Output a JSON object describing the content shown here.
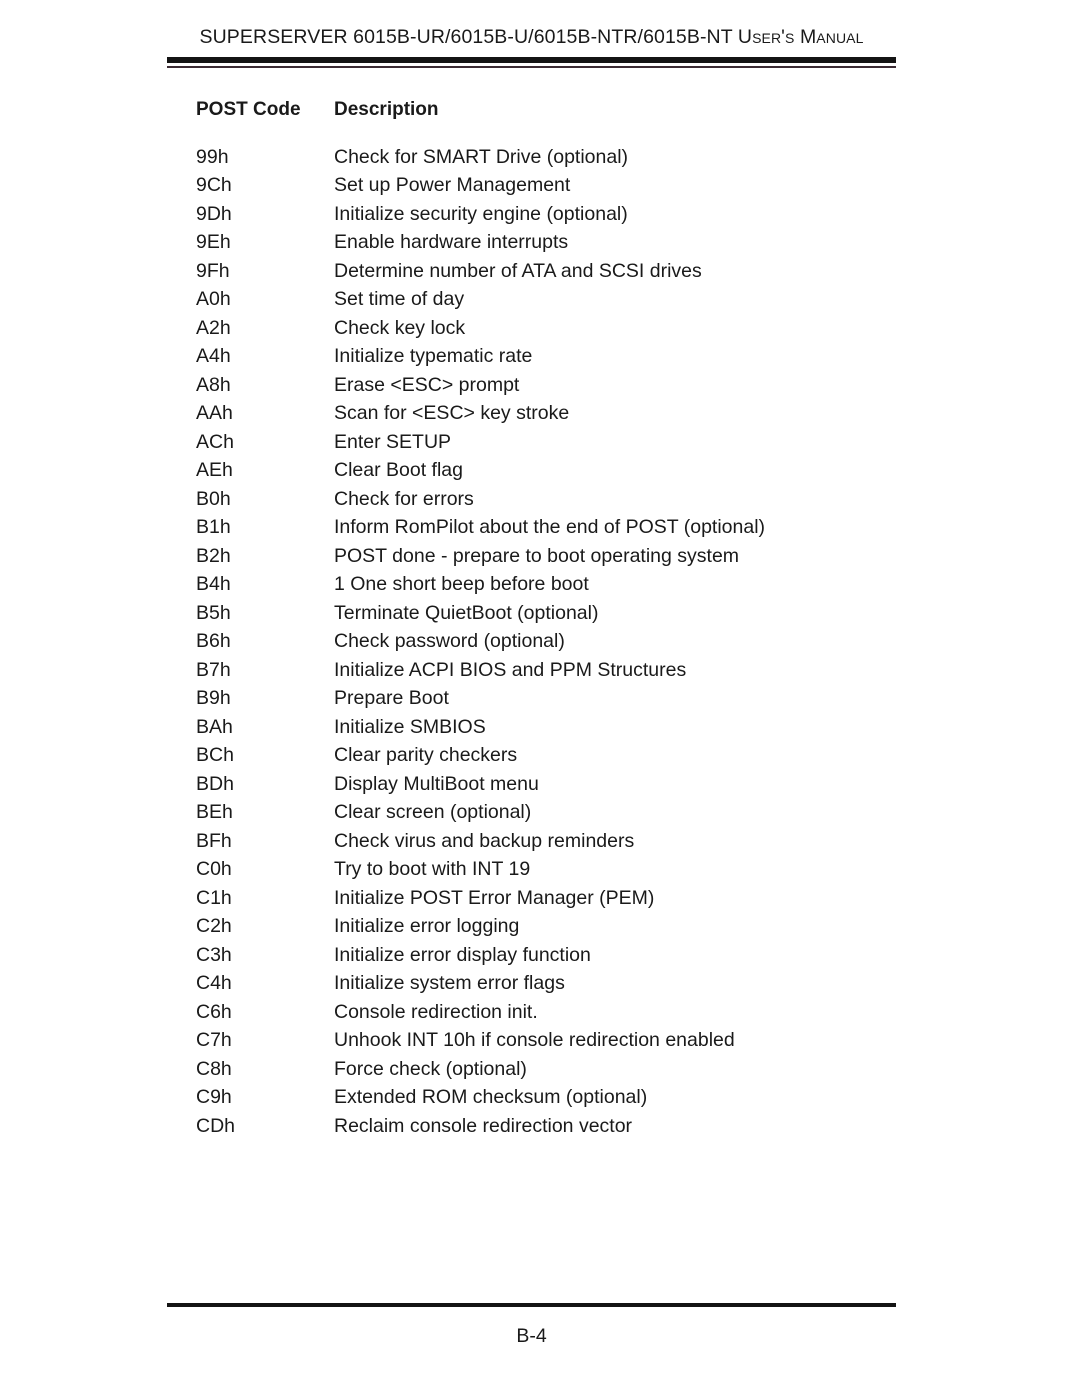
{
  "header": {
    "title": "SUPERSERVER 6015B-UR/6015B-U/6015B-NTR/6015B-NT User's Manual"
  },
  "table": {
    "columns": [
      "POST Code",
      "Description"
    ],
    "rows": [
      {
        "code": "99h",
        "description": "Check for SMART Drive (optional)"
      },
      {
        "code": "9Ch",
        "description": "Set up Power Management"
      },
      {
        "code": "9Dh",
        "description": "Initialize security engine (optional)"
      },
      {
        "code": "9Eh",
        "description": "Enable hardware interrupts"
      },
      {
        "code": "9Fh",
        "description": "Determine number of ATA and SCSI drives"
      },
      {
        "code": "A0h",
        "description": "Set time of day"
      },
      {
        "code": "A2h",
        "description": "Check key lock"
      },
      {
        "code": "A4h",
        "description": "Initialize typematic rate"
      },
      {
        "code": "A8h",
        "description": "Erase <ESC> prompt"
      },
      {
        "code": "AAh",
        "description": "Scan for <ESC> key stroke"
      },
      {
        "code": "ACh",
        "description": "Enter SETUP"
      },
      {
        "code": "AEh",
        "description": "Clear Boot flag"
      },
      {
        "code": "B0h",
        "description": "Check for errors"
      },
      {
        "code": "B1h",
        "description": "Inform RomPilot about the end of POST (optional)"
      },
      {
        "code": "B2h",
        "description": "POST done - prepare to boot operating system"
      },
      {
        "code": "B4h",
        "description": "1 One short beep before boot"
      },
      {
        "code": "B5h",
        "description": "Terminate QuietBoot (optional)"
      },
      {
        "code": "B6h",
        "description": "Check password (optional)"
      },
      {
        "code": "B7h",
        "description": "Initialize ACPI BIOS and PPM Structures"
      },
      {
        "code": "B9h",
        "description": "Prepare Boot"
      },
      {
        "code": "BAh",
        "description": "Initialize SMBIOS"
      },
      {
        "code": "BCh",
        "description": "Clear parity checkers"
      },
      {
        "code": "BDh",
        "description": "Display MultiBoot menu"
      },
      {
        "code": "BEh",
        "description": "Clear screen (optional)"
      },
      {
        "code": "BFh",
        "description": "Check virus and backup reminders"
      },
      {
        "code": "C0h",
        "description": "Try to boot with INT 19"
      },
      {
        "code": "C1h",
        "description": "Initialize POST Error Manager (PEM)"
      },
      {
        "code": "C2h",
        "description": "Initialize error logging"
      },
      {
        "code": "C3h",
        "description": "Initialize error display function"
      },
      {
        "code": "C4h",
        "description": "Initialize system error flags"
      },
      {
        "code": "C6h",
        "description": "Console redirection init."
      },
      {
        "code": "C7h",
        "description": "Unhook INT 10h if console redirection enabled"
      },
      {
        "code": "C8h",
        "description": "Force check (optional)"
      },
      {
        "code": "C9h",
        "description": "Extended ROM checksum (optional)"
      },
      {
        "code": "CDh",
        "description": "Reclaim console redirection vector"
      }
    ]
  },
  "footer": {
    "page_number": "B-4"
  }
}
